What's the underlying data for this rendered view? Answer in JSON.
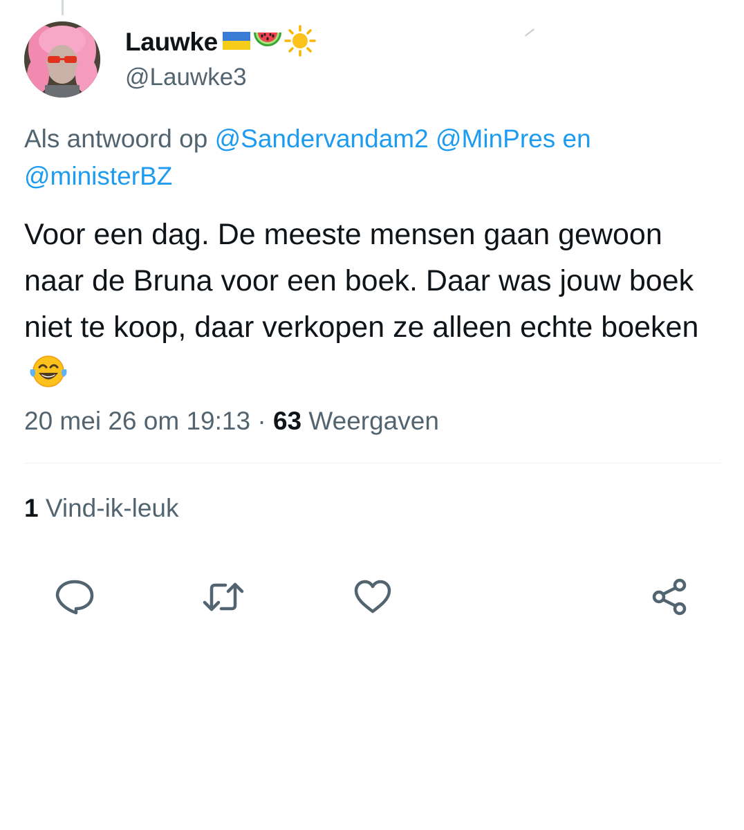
{
  "tweet": {
    "author": {
      "display_name": "Lauwke",
      "name_emojis": [
        "ukraine-flag-icon",
        "watermelon-icon",
        "sun-icon"
      ],
      "handle": "@Lauwke3"
    },
    "reply_to": {
      "prefix": "Als antwoord op",
      "mentions": [
        "@Sandervandam2",
        "@MinPres",
        "@ministerBZ"
      ],
      "connector": "en"
    },
    "text": "Voor een dag. De meeste mensen gaan gewoon naar de Bruna voor een boek. Daar was jouw boek niet te koop, daar verkopen ze alleen echte boeken",
    "text_emoji": "tears-of-joy-icon",
    "timestamp": "20 mei 26 om 19:13",
    "separator": "·",
    "views_count": "63",
    "views_label": "Weergaven",
    "likes_count": "1",
    "likes_label": "Vind-ik-leuk"
  },
  "actions": [
    {
      "name": "reply",
      "icon": "reply-icon"
    },
    {
      "name": "retweet",
      "icon": "retweet-icon"
    },
    {
      "name": "like",
      "icon": "heart-icon"
    },
    {
      "name": "share",
      "icon": "share-icon"
    }
  ],
  "colors": {
    "text_primary": "#0f1419",
    "text_secondary": "#536471",
    "link": "#1d9bf0",
    "divider": "#eff3f4"
  }
}
